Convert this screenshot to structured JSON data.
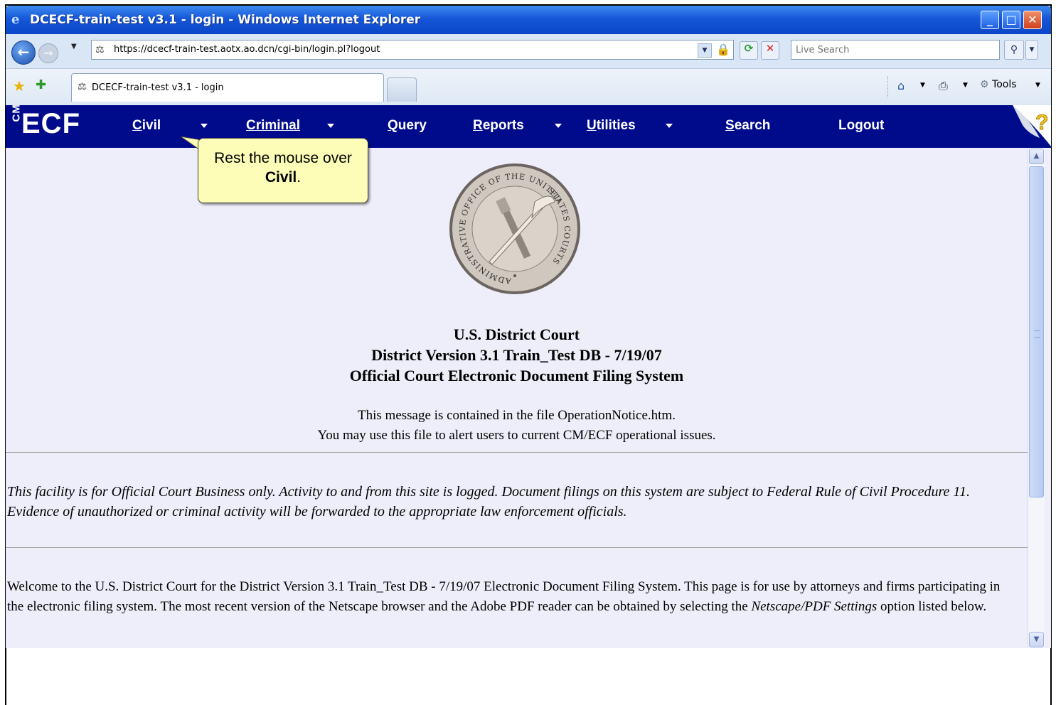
{
  "window": {
    "title": "DCECF-train-test v3.1 - login - Windows Internet Explorer",
    "minimize_glyph": "_",
    "maximize_glyph": "□",
    "close_glyph": "✕"
  },
  "address_bar": {
    "url": "https://dcecf-train-test.aotx.ao.dcn/cgi-bin/login.pl?logout",
    "search_placeholder": "Live Search"
  },
  "tab": {
    "label": "DCECF-train-test v3.1 - login"
  },
  "command_bar": {
    "tools_label": "Tools"
  },
  "ecf_menu": {
    "logo_prefix": "CM",
    "logo_text": "ECF",
    "items": [
      {
        "first": "C",
        "rest": "ivil",
        "has_dropdown": true
      },
      {
        "first": "",
        "rest": "Criminal",
        "has_dropdown": true
      },
      {
        "first": "Q",
        "rest": "uery",
        "has_dropdown": false
      },
      {
        "first": "R",
        "rest": "eports",
        "has_dropdown": true
      },
      {
        "first": "U",
        "rest": "tilities",
        "has_dropdown": true
      },
      {
        "first": "S",
        "rest": "earch",
        "has_dropdown": false
      },
      {
        "first": "",
        "rest": "Logout",
        "has_dropdown": false
      }
    ],
    "help_glyph": "?"
  },
  "callout": {
    "line1": "Rest the mouse over",
    "line2_bold": "Civil",
    "line2_end": "."
  },
  "seal": {
    "text_top": "OFFICE OF THE UNITED",
    "text_left": "ADMINISTRATIVE",
    "text_right": "STATES COURTS"
  },
  "court": {
    "line1": "U.S. District Court",
    "line2": "District Version 3.1 Train_Test DB - 7/19/07",
    "line3": "Official Court Electronic Document Filing System"
  },
  "notice": {
    "line1": "This message is contained in the file OperationNotice.htm.",
    "line2": "You may use this file to alert users to current CM/ECF operational issues."
  },
  "warning": "This facility is for Official Court Business only. Activity to and from this site is logged. Document filings on this system are subject to Federal Rule of Civil Procedure 11. Evidence of unauthorized or criminal activity will be forwarded to the appropriate law enforcement officials.",
  "welcome": {
    "before": "Welcome to the U.S. District Court for the District Version 3.1 Train_Test DB - 7/19/07 Electronic Document Filing System. This page is for use by attorneys and firms participating in the electronic filing system. The most recent version of the Netscape browser and the Adobe PDF reader can be obtained by selecting the ",
    "emphasis": "Netscape/PDF Settings",
    "after": " option listed below."
  },
  "colors": {
    "menubar": "#000b8c",
    "page_bg": "#eeeefa",
    "callout_bg": "#fdfdb8"
  }
}
